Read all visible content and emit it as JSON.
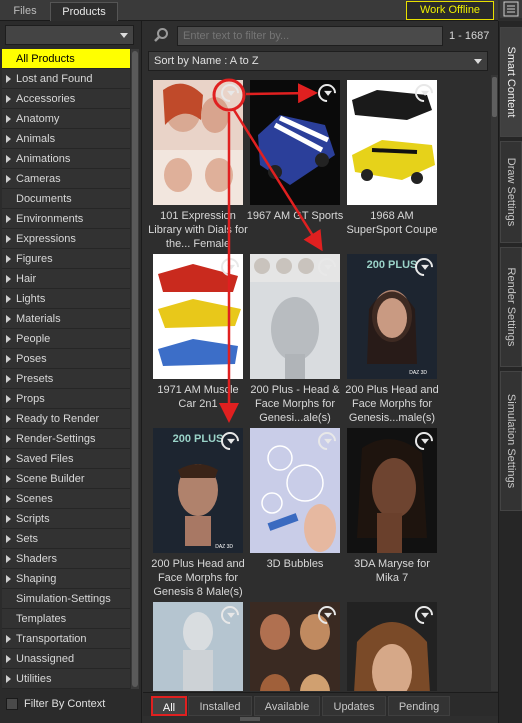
{
  "top_tabs": {
    "files": "Files",
    "products": "Products"
  },
  "work_offline": "Work Offline",
  "left": {
    "categories": [
      {
        "label": "All Products",
        "expandable": false,
        "selected": true
      },
      {
        "label": "Lost and Found",
        "expandable": true
      },
      {
        "label": "Accessories",
        "expandable": true
      },
      {
        "label": "Anatomy",
        "expandable": true
      },
      {
        "label": "Animals",
        "expandable": true
      },
      {
        "label": "Animations",
        "expandable": true
      },
      {
        "label": "Cameras",
        "expandable": true
      },
      {
        "label": "Documents",
        "expandable": false
      },
      {
        "label": "Environments",
        "expandable": true
      },
      {
        "label": "Expressions",
        "expandable": true
      },
      {
        "label": "Figures",
        "expandable": true
      },
      {
        "label": "Hair",
        "expandable": true
      },
      {
        "label": "Lights",
        "expandable": true
      },
      {
        "label": "Materials",
        "expandable": true
      },
      {
        "label": "People",
        "expandable": true
      },
      {
        "label": "Poses",
        "expandable": true
      },
      {
        "label": "Presets",
        "expandable": true
      },
      {
        "label": "Props",
        "expandable": true
      },
      {
        "label": "Ready to Render",
        "expandable": true
      },
      {
        "label": "Render-Settings",
        "expandable": true
      },
      {
        "label": "Saved Files",
        "expandable": true
      },
      {
        "label": "Scene Builder",
        "expandable": true
      },
      {
        "label": "Scenes",
        "expandable": true
      },
      {
        "label": "Scripts",
        "expandable": true
      },
      {
        "label": "Sets",
        "expandable": true
      },
      {
        "label": "Shaders",
        "expandable": true
      },
      {
        "label": "Shaping",
        "expandable": true
      },
      {
        "label": "Simulation-Settings",
        "expandable": false
      },
      {
        "label": "Templates",
        "expandable": false
      },
      {
        "label": "Transportation",
        "expandable": true
      },
      {
        "label": "Unassigned",
        "expandable": true
      },
      {
        "label": "Utilities",
        "expandable": true
      }
    ],
    "filter_by_context": "Filter By Context"
  },
  "search": {
    "placeholder": "Enter text to filter by...",
    "range": "1 - 1687"
  },
  "sort": {
    "label": "Sort by Name : A to Z"
  },
  "products": [
    {
      "label": "101 Expression Library with Dials for the... Female"
    },
    {
      "label": "1967 AM GT Sports"
    },
    {
      "label": "1968 AM SuperSport Coupe"
    },
    {
      "label": "1971 AM Muscle Car 2n1"
    },
    {
      "label": "200 Plus - Head & Face Morphs for Genesi...ale(s)"
    },
    {
      "label": "200 Plus Head and Face Morphs for Genesis...male(s)"
    },
    {
      "label": "200 Plus Head and Face Morphs for Genesis 8 Male(s)"
    },
    {
      "label": "3D Bubbles"
    },
    {
      "label": "3DA Maryse for Mika 7"
    },
    {
      "label": ""
    },
    {
      "label": ""
    },
    {
      "label": ""
    }
  ],
  "bottom_tabs": [
    "All",
    "Installed",
    "Available",
    "Updates",
    "Pending"
  ],
  "side_tabs": [
    "Smart Content",
    "Draw Settings",
    "Render Settings",
    "Simulation Settings"
  ],
  "colors": {
    "selected": "#ffff00",
    "accent_red": "#e02020",
    "offline": "#f0f000"
  },
  "thumb_text": {
    "plus_logo": "200 PLUS",
    "daz_badge": "DAZ 3D"
  }
}
